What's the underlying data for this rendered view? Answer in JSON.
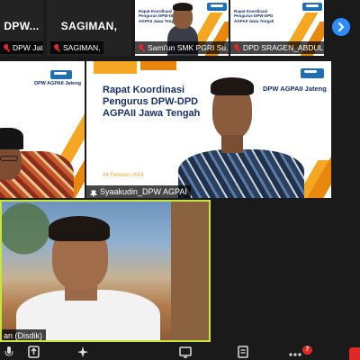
{
  "window": {
    "view": "gallery"
  },
  "strip": {
    "tiles": [
      {
        "big_name": "DPW...",
        "label": "DPW Jateng"
      },
      {
        "big_name": "SAGIMAN,",
        "label": "SAGIMAN,"
      },
      {
        "label": "Sami'un SMK PGRI Su..."
      },
      {
        "label": "DPD SRAGEN_ABDUL ..."
      }
    ],
    "slide_title_lines": [
      "Rapat Koordinasi",
      "Pengurus DPW-DPD",
      "AGPAII Jawa Tengah"
    ]
  },
  "gallery": {
    "top_left": {
      "logo_text": "DPW AGPAII Jateng"
    },
    "center": {
      "slide_title_lines": [
        "Rapat Koordinasi",
        "Pengurus DPW-DPD",
        "AGPAII Jawa Tengah"
      ],
      "logo_text": "DPW AGPAII Jateng",
      "date_text": "24 Februari 2024",
      "label": "Syaakudin_DPW AGPAI"
    },
    "speaker": {
      "label": "an (Disdik)"
    }
  },
  "toolbar": {
    "badge_count": "7"
  },
  "colors": {
    "accent": "#2d8cff",
    "active_speaker": "#c6e63c",
    "muted": "#e02828",
    "slide_orange": "#f5a623",
    "slide_navy": "#17306a"
  },
  "icons": [
    "chevron-right-icon",
    "mic-muted-icon",
    "pin-icon",
    "share-screen-icon",
    "reactions-icon",
    "more-icon"
  ]
}
